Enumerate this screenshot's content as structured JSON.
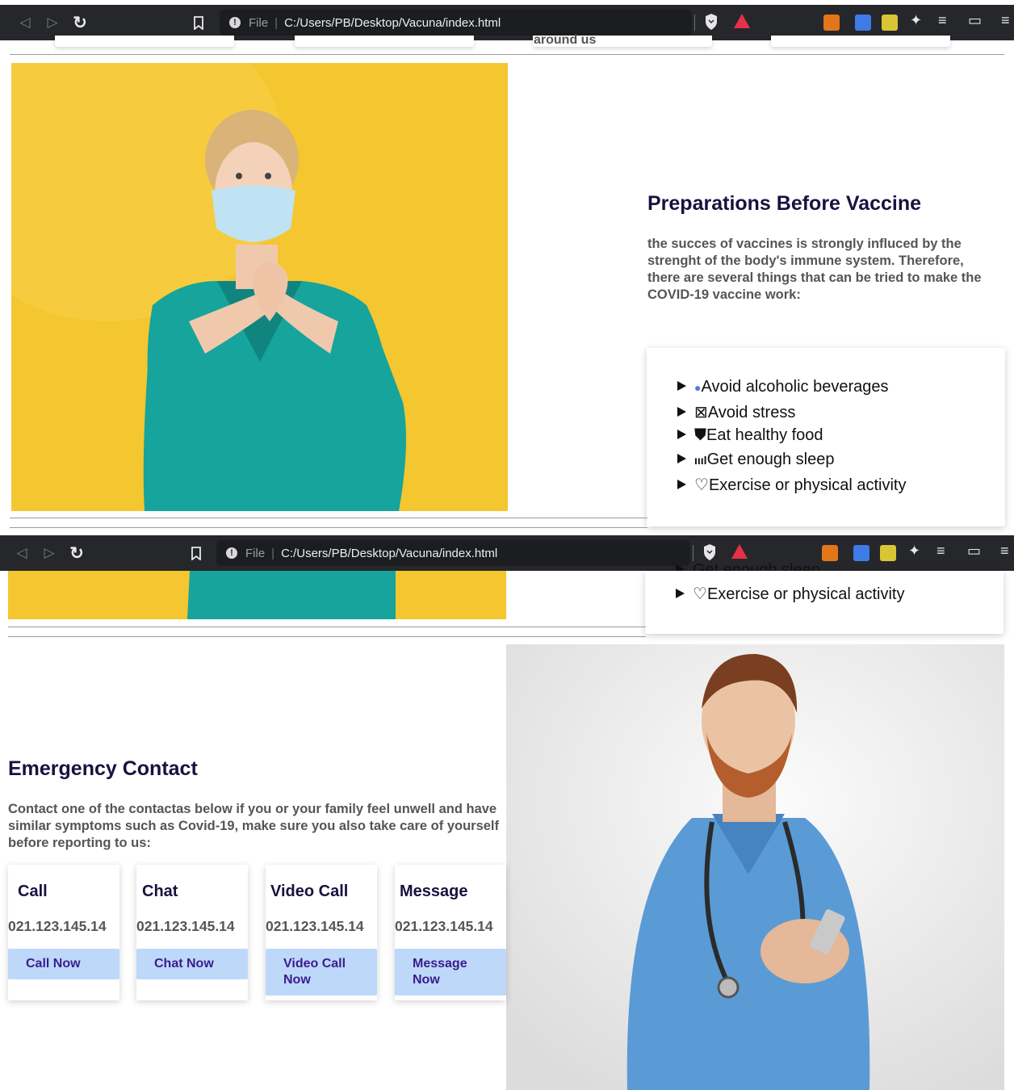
{
  "browser": {
    "file_label": "File",
    "url": "C:/Users/PB/Desktop/Vacuna/index.html"
  },
  "top_fragment": {
    "text": "around us"
  },
  "preparations": {
    "title": "Preparations Before Vaccine",
    "body": "the succes of vaccines is strongly influced by the strenght of the body's immune system. Therefore, there are several things that can be tried to make the COVID-19 vaccine work:",
    "items": [
      {
        "icon": "shield-dot-icon",
        "glyph": "●",
        "label": "Avoid alcoholic beverages"
      },
      {
        "icon": "boxed-x-icon",
        "glyph": "⊠",
        "label": "Avoid stress"
      },
      {
        "icon": "shield-check-icon",
        "glyph": "⛊",
        "label": "Eat healthy food"
      },
      {
        "icon": "signal-bars-icon",
        "glyph": "ıııl",
        "label": "Get enough sleep"
      },
      {
        "icon": "heart-outline-icon",
        "glyph": "♡",
        "label": "Exercise or physical activity"
      }
    ],
    "partial_item": "Get enough sleep"
  },
  "emergency": {
    "title": "Emergency Contact",
    "body": "Contact one of the contactas below if you or your family feel unwell and have similar symptoms such as Covid-19, make sure you also take care of yourself before reporting to us:",
    "cards": [
      {
        "title": "Call",
        "number": "021.123.145.14",
        "button": "Call Now"
      },
      {
        "title": "Chat",
        "number": "021.123.145.14",
        "button": "Chat Now"
      },
      {
        "title": "Video Call",
        "number": "021.123.145.14",
        "button": "Video Call Now"
      },
      {
        "title": "Message",
        "number": "021.123.145.14",
        "button": "Message Now"
      }
    ]
  },
  "colors": {
    "heading": "#17123f",
    "button_bg": "#bed8fa",
    "button_text": "#3b1c8c",
    "yellow_bg": "#f4c630",
    "scrub_teal": "#16a49c"
  }
}
